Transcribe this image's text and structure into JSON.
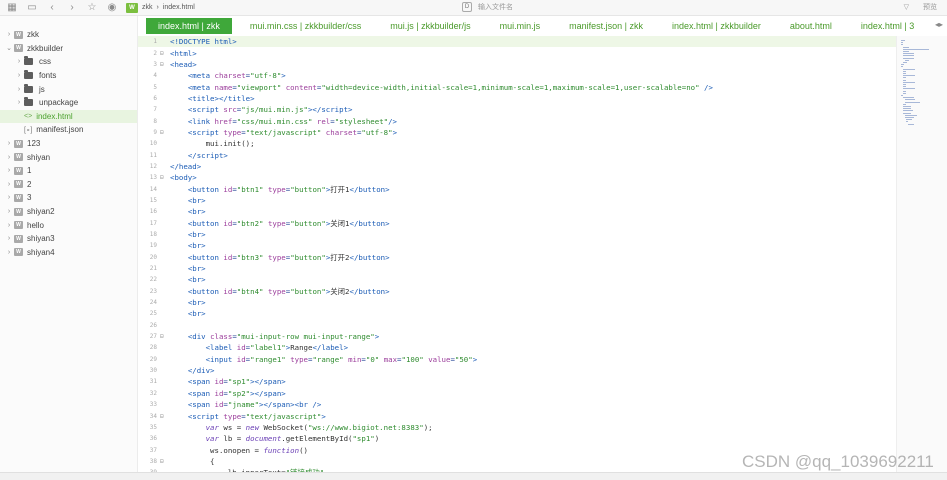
{
  "toolbar": {
    "breadcrumb": [
      "zkk",
      "index.html"
    ],
    "search_placeholder": "输入文件名",
    "right_label": "预览"
  },
  "sidebar": {
    "items": [
      {
        "label": "zkk",
        "type": "project",
        "level": 0,
        "expanded": false
      },
      {
        "label": "zkkbuilder",
        "type": "project",
        "level": 0,
        "expanded": true
      },
      {
        "label": "css",
        "type": "folder",
        "level": 1,
        "expanded": false
      },
      {
        "label": "fonts",
        "type": "folder",
        "level": 1,
        "expanded": false
      },
      {
        "label": "js",
        "type": "folder",
        "level": 1,
        "expanded": false
      },
      {
        "label": "unpackage",
        "type": "folder",
        "level": 1,
        "expanded": false
      },
      {
        "label": "index.html",
        "type": "html",
        "level": 1,
        "active": true
      },
      {
        "label": "manifest.json",
        "type": "json",
        "level": 1
      },
      {
        "label": "123",
        "type": "project",
        "level": 0,
        "expanded": false
      },
      {
        "label": "shiyan",
        "type": "project",
        "level": 0,
        "expanded": false
      },
      {
        "label": "1",
        "type": "project",
        "level": 0,
        "expanded": false
      },
      {
        "label": "2",
        "type": "project",
        "level": 0,
        "expanded": false
      },
      {
        "label": "3",
        "type": "project",
        "level": 0,
        "expanded": false
      },
      {
        "label": "shiyan2",
        "type": "project",
        "level": 0,
        "expanded": false
      },
      {
        "label": "hello",
        "type": "project",
        "level": 0,
        "expanded": false
      },
      {
        "label": "shiyan3",
        "type": "project",
        "level": 0,
        "expanded": false
      },
      {
        "label": "shiyan4",
        "type": "project",
        "level": 0,
        "expanded": false
      }
    ]
  },
  "tabs": [
    {
      "label": "index.html | zkk",
      "active": true
    },
    {
      "label": "mui.min.css | zkkbuilder/css"
    },
    {
      "label": "mui.js | zkkbuilder/js"
    },
    {
      "label": "mui.min.js"
    },
    {
      "label": "manifest.json | zkk"
    },
    {
      "label": "index.html | zkkbuilder"
    },
    {
      "label": "about.html"
    },
    {
      "label": "index.html | 3"
    }
  ],
  "editor": {
    "lines": [
      {
        "n": "1",
        "fold": "",
        "html": "<span class=\"tag\">&lt;!DOCTYPE html&gt;</span>",
        "hl": true
      },
      {
        "n": "2",
        "fold": "⊟",
        "html": "<span class=\"tag\">&lt;html&gt;</span>"
      },
      {
        "n": "3",
        "fold": "⊟",
        "html": "<span class=\"tag\">&lt;head&gt;</span>"
      },
      {
        "n": "4",
        "fold": "",
        "html": "    <span class=\"tag\">&lt;meta</span> <span class=\"attr\">charset</span>=<span class=\"str\">\"utf-8\"</span><span class=\"tag\">&gt;</span>"
      },
      {
        "n": "5",
        "fold": "",
        "html": "    <span class=\"tag\">&lt;meta</span> <span class=\"attr\">name</span>=<span class=\"str\">\"viewport\"</span> <span class=\"attr\">content</span>=<span class=\"str\">\"width=device-width,initial-scale=1,minimum-scale=1,maximum-scale=1,user-scalable=no\"</span> <span class=\"tag\">/&gt;</span>"
      },
      {
        "n": "6",
        "fold": "",
        "html": "    <span class=\"tag\">&lt;title&gt;&lt;/title&gt;</span>"
      },
      {
        "n": "7",
        "fold": "",
        "html": "    <span class=\"tag\">&lt;script</span> <span class=\"attr\">src</span>=<span class=\"str\">\"js/mui.min.js\"</span><span class=\"tag\">&gt;&lt;/script&gt;</span>"
      },
      {
        "n": "8",
        "fold": "",
        "html": "    <span class=\"tag\">&lt;link</span> <span class=\"attr\">href</span>=<span class=\"str\">\"css/mui.min.css\"</span> <span class=\"attr\">rel</span>=<span class=\"str\">\"stylesheet\"</span><span class=\"tag\">/&gt;</span>"
      },
      {
        "n": "9",
        "fold": "⊟",
        "html": "    <span class=\"tag\">&lt;script</span> <span class=\"attr\">type</span>=<span class=\"str\">\"text/javascript\"</span> <span class=\"attr\">charset</span>=<span class=\"str\">\"utf-8\"</span><span class=\"tag\">&gt;</span>"
      },
      {
        "n": "10",
        "fold": "",
        "html": "        <span class=\"txt\">mui.init();</span>"
      },
      {
        "n": "11",
        "fold": "",
        "html": "    <span class=\"tag\">&lt;/script&gt;</span>"
      },
      {
        "n": "12",
        "fold": "",
        "html": "<span class=\"tag\">&lt;/head&gt;</span>"
      },
      {
        "n": "13",
        "fold": "⊟",
        "html": "<span class=\"tag\">&lt;body&gt;</span>"
      },
      {
        "n": "14",
        "fold": "",
        "html": "    <span class=\"tag\">&lt;button</span> <span class=\"attr\">id</span>=<span class=\"str\">\"btn1\"</span> <span class=\"attr\">type</span>=<span class=\"str\">\"button\"</span><span class=\"tag\">&gt;</span><span class=\"txt\">打开1</span><span class=\"tag\">&lt;/button&gt;</span>"
      },
      {
        "n": "15",
        "fold": "",
        "html": "    <span class=\"tag\">&lt;br&gt;</span>"
      },
      {
        "n": "16",
        "fold": "",
        "html": "    <span class=\"tag\">&lt;br&gt;</span>"
      },
      {
        "n": "17",
        "fold": "",
        "html": "    <span class=\"tag\">&lt;button</span> <span class=\"attr\">id</span>=<span class=\"str\">\"btn2\"</span> <span class=\"attr\">type</span>=<span class=\"str\">\"button\"</span><span class=\"tag\">&gt;</span><span class=\"txt\">关闭1</span><span class=\"tag\">&lt;/button&gt;</span>"
      },
      {
        "n": "18",
        "fold": "",
        "html": "    <span class=\"tag\">&lt;br&gt;</span>"
      },
      {
        "n": "19",
        "fold": "",
        "html": "    <span class=\"tag\">&lt;br&gt;</span>"
      },
      {
        "n": "20",
        "fold": "",
        "html": "    <span class=\"tag\">&lt;button</span> <span class=\"attr\">id</span>=<span class=\"str\">\"btn3\"</span> <span class=\"attr\">type</span>=<span class=\"str\">\"button\"</span><span class=\"tag\">&gt;</span><span class=\"txt\">打开2</span><span class=\"tag\">&lt;/button&gt;</span>"
      },
      {
        "n": "21",
        "fold": "",
        "html": "    <span class=\"tag\">&lt;br&gt;</span>"
      },
      {
        "n": "22",
        "fold": "",
        "html": "    <span class=\"tag\">&lt;br&gt;</span>"
      },
      {
        "n": "23",
        "fold": "",
        "html": "    <span class=\"tag\">&lt;button</span> <span class=\"attr\">id</span>=<span class=\"str\">\"btn4\"</span> <span class=\"attr\">type</span>=<span class=\"str\">\"button\"</span><span class=\"tag\">&gt;</span><span class=\"txt\">关闭2</span><span class=\"tag\">&lt;/button&gt;</span>"
      },
      {
        "n": "24",
        "fold": "",
        "html": "    <span class=\"tag\">&lt;br&gt;</span>"
      },
      {
        "n": "25",
        "fold": "",
        "html": "    <span class=\"tag\">&lt;br&gt;</span>"
      },
      {
        "n": "26",
        "fold": "",
        "html": ""
      },
      {
        "n": "27",
        "fold": "⊟",
        "html": "    <span class=\"tag\">&lt;div</span> <span class=\"attr\">class</span>=<span class=\"str\">\"mui-input-row mui-input-range\"</span><span class=\"tag\">&gt;</span>"
      },
      {
        "n": "28",
        "fold": "",
        "html": "        <span class=\"tag\">&lt;label</span> <span class=\"attr\">id</span>=<span class=\"str\">\"label1\"</span><span class=\"tag\">&gt;</span><span class=\"txt\">Range</span><span class=\"tag\">&lt;/label&gt;</span>"
      },
      {
        "n": "29",
        "fold": "",
        "html": "        <span class=\"tag\">&lt;input</span> <span class=\"attr\">id</span>=<span class=\"str\">\"range1\"</span> <span class=\"attr\">type</span>=<span class=\"str\">\"range\"</span> <span class=\"attr\">min</span>=<span class=\"str\">\"0\"</span> <span class=\"attr\">max</span>=<span class=\"str\">\"100\"</span> <span class=\"attr\">value</span>=<span class=\"str\">\"50\"</span><span class=\"tag\">&gt;</span>"
      },
      {
        "n": "30",
        "fold": "",
        "html": "    <span class=\"tag\">&lt;/div&gt;</span>"
      },
      {
        "n": "31",
        "fold": "",
        "html": "    <span class=\"tag\">&lt;span</span> <span class=\"attr\">id</span>=<span class=\"str\">\"sp1\"</span><span class=\"tag\">&gt;&lt;/span&gt;</span>"
      },
      {
        "n": "32",
        "fold": "",
        "html": "    <span class=\"tag\">&lt;span</span> <span class=\"attr\">id</span>=<span class=\"str\">\"sp2\"</span><span class=\"tag\">&gt;&lt;/span&gt;</span>"
      },
      {
        "n": "33",
        "fold": "",
        "html": "    <span class=\"tag\">&lt;span</span> <span class=\"attr\">id</span>=<span class=\"str\">\"jname\"</span><span class=\"tag\">&gt;&lt;/span&gt;&lt;br /&gt;</span>"
      },
      {
        "n": "34",
        "fold": "⊟",
        "html": "    <span class=\"tag\">&lt;script</span> <span class=\"attr\">type</span>=<span class=\"str\">\"text/javascript\"</span><span class=\"tag\">&gt;</span>"
      },
      {
        "n": "35",
        "fold": "",
        "html": "        <span class=\"kw\">var</span> <span class=\"txt\">ws = </span><span class=\"kw\">new</span> <span class=\"txt\">WebSocket(</span><span class=\"str\">\"ws://www.bigiot.net:8383\"</span><span class=\"txt\">);</span>"
      },
      {
        "n": "36",
        "fold": "",
        "html": "        <span class=\"kw\">var</span> <span class=\"txt\">lb = </span><span class=\"kw\">document</span><span class=\"txt\">.getElementById(</span><span class=\"str\">\"sp1\"</span><span class=\"txt\">)</span>"
      },
      {
        "n": "37",
        "fold": "",
        "html": "         <span class=\"txt\">ws.onopen = </span><span class=\"kw\">function</span><span class=\"txt\">()</span>"
      },
      {
        "n": "38",
        "fold": "⊟",
        "html": "         <span class=\"txt\">{</span>"
      },
      {
        "n": "39",
        "fold": "",
        "html": "             <span class=\"txt\">lb.innerText=</span><span class=\"str\">\"链接成功\"</span>"
      }
    ]
  },
  "watermark": "CSDN @qq_1039692211"
}
